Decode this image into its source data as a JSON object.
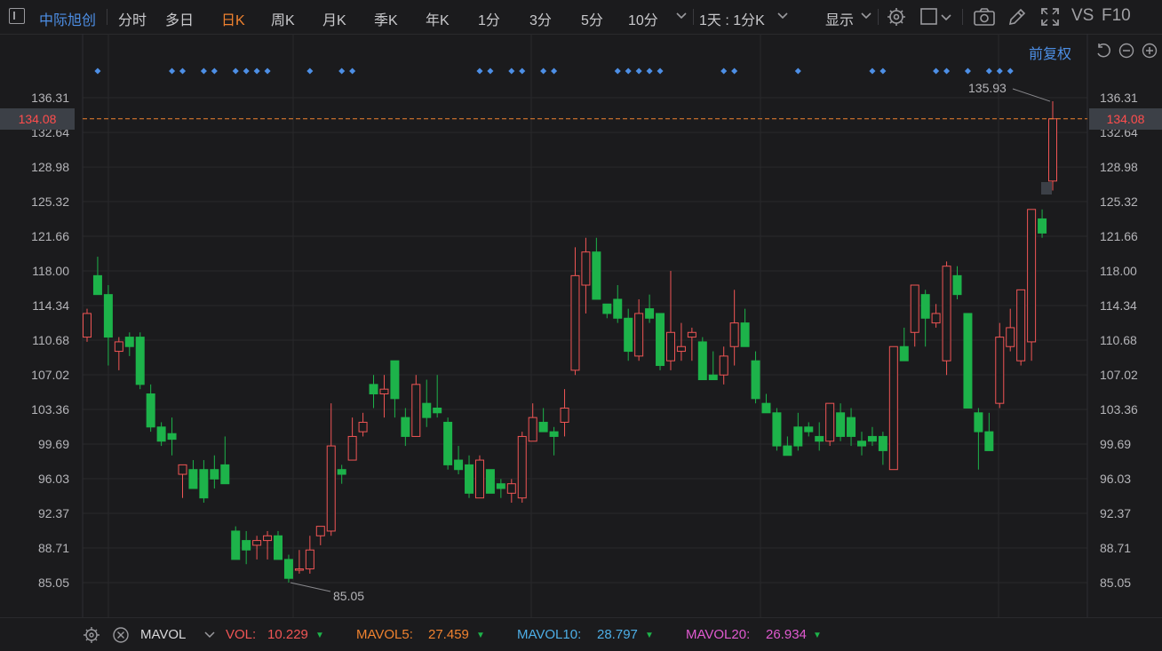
{
  "toolbar": {
    "stock_name": "中际旭创",
    "periods": [
      "分时",
      "多日",
      "日K",
      "周K",
      "月K",
      "季K",
      "年K",
      "1分",
      "3分",
      "5分",
      "10分"
    ],
    "active_period": "日K",
    "period_dropdown": "1天 : 1分K",
    "display_label": "显示",
    "vs_label": "VS",
    "f10_label": "F10"
  },
  "chart": {
    "adjust_label": "前复权",
    "current_price": "134.08",
    "high_label": "135.93",
    "low_label": "85.05",
    "y_ticks": [
      "136.31",
      "132.64",
      "128.98",
      "125.32",
      "121.66",
      "118.00",
      "114.34",
      "110.68",
      "107.02",
      "103.36",
      "99.69",
      "96.03",
      "92.37",
      "88.71",
      "85.05"
    ],
    "colors": {
      "up": "#f05555",
      "down": "#1db34a",
      "accent": "#f0822f",
      "blue": "#4d8fe6"
    }
  },
  "chart_data": {
    "type": "candlestick",
    "ylim": [
      83.0,
      139.0
    ],
    "ohlc": [
      [
        111.0,
        114.0,
        110.5,
        113.5
      ],
      [
        117.5,
        119.5,
        115.5,
        115.5
      ],
      [
        115.5,
        116.5,
        108.0,
        111.0
      ],
      [
        109.5,
        111.0,
        107.5,
        110.5
      ],
      [
        111.0,
        111.5,
        109.0,
        110.0
      ],
      [
        111.0,
        111.5,
        105.5,
        106.0
      ],
      [
        105.0,
        106.0,
        101.0,
        101.5
      ],
      [
        101.5,
        102.0,
        99.5,
        100.0
      ],
      [
        100.8,
        102.5,
        98.5,
        100.2
      ],
      [
        96.5,
        97.5,
        94.0,
        97.5
      ],
      [
        97.0,
        98.0,
        95.0,
        95.0
      ],
      [
        97.0,
        98.0,
        93.5,
        94.0
      ],
      [
        97.0,
        98.5,
        95.0,
        96.0
      ],
      [
        97.5,
        100.5,
        95.5,
        95.5
      ],
      [
        90.5,
        91.0,
        87.5,
        87.5
      ],
      [
        89.5,
        90.5,
        87.0,
        88.5
      ],
      [
        89.0,
        90.0,
        87.5,
        89.5
      ],
      [
        89.5,
        90.5,
        87.5,
        90.0
      ],
      [
        90.0,
        90.5,
        87.5,
        87.5
      ],
      [
        87.5,
        88.0,
        85.05,
        85.5
      ],
      [
        86.5,
        88.5,
        86.0,
        86.5
      ],
      [
        86.5,
        90.0,
        86.0,
        88.5
      ],
      [
        90.0,
        91.0,
        89.0,
        91.0
      ],
      [
        90.5,
        104.0,
        90.0,
        99.5
      ],
      [
        97.0,
        97.5,
        95.5,
        96.5
      ],
      [
        98.0,
        102.5,
        98.0,
        100.5
      ],
      [
        101.0,
        103.0,
        100.5,
        102.0
      ],
      [
        106.0,
        107.0,
        103.5,
        105.0
      ],
      [
        105.0,
        107.0,
        102.5,
        105.5
      ],
      [
        108.5,
        108.5,
        102.5,
        104.5
      ],
      [
        102.5,
        103.5,
        99.5,
        100.5
      ],
      [
        100.5,
        107.0,
        100.5,
        106.0
      ],
      [
        104.0,
        106.5,
        101.5,
        102.5
      ],
      [
        103.5,
        107.0,
        102.5,
        103.0
      ],
      [
        102.0,
        102.5,
        97.0,
        97.5
      ],
      [
        98.0,
        99.5,
        96.5,
        97.0
      ],
      [
        97.5,
        98.5,
        94.0,
        94.5
      ],
      [
        94.0,
        98.5,
        94.0,
        98.0
      ],
      [
        97.0,
        97.0,
        94.5,
        94.5
      ],
      [
        95.5,
        96.0,
        94.0,
        95.0
      ],
      [
        94.5,
        96.0,
        93.5,
        95.5
      ],
      [
        94.0,
        101.0,
        93.5,
        100.5
      ],
      [
        100.0,
        104.0,
        100.0,
        102.5
      ],
      [
        102.0,
        103.5,
        101.0,
        101.0
      ],
      [
        101.0,
        101.5,
        98.5,
        100.5
      ],
      [
        102.0,
        105.5,
        100.5,
        103.5
      ],
      [
        107.5,
        120.5,
        107.0,
        117.5
      ],
      [
        116.5,
        121.5,
        113.5,
        120.0
      ],
      [
        120.0,
        121.5,
        115.0,
        115.0
      ],
      [
        114.5,
        114.5,
        113.0,
        113.5
      ],
      [
        115.0,
        116.5,
        112.5,
        113.0
      ],
      [
        113.0,
        114.0,
        108.5,
        109.5
      ],
      [
        109.0,
        115.0,
        108.5,
        113.5
      ],
      [
        114.0,
        115.5,
        112.5,
        113.0
      ],
      [
        113.5,
        113.5,
        107.5,
        108.0
      ],
      [
        108.5,
        118.0,
        107.5,
        111.5
      ],
      [
        109.5,
        112.5,
        108.5,
        110.0
      ],
      [
        111.0,
        112.0,
        108.5,
        111.5
      ],
      [
        110.5,
        111.0,
        106.5,
        106.5
      ],
      [
        107.0,
        109.5,
        106.5,
        106.5
      ],
      [
        107.0,
        110.0,
        106.0,
        109.0
      ],
      [
        110.0,
        116.0,
        108.0,
        112.5
      ],
      [
        112.5,
        114.0,
        110.0,
        110.0
      ],
      [
        108.5,
        109.5,
        104.0,
        104.5
      ],
      [
        104.0,
        105.0,
        103.0,
        103.0
      ],
      [
        103.0,
        103.5,
        99.0,
        99.5
      ],
      [
        99.5,
        100.5,
        98.5,
        98.5
      ],
      [
        101.5,
        103.0,
        99.0,
        99.5
      ],
      [
        101.5,
        102.0,
        100.5,
        101.0
      ],
      [
        100.5,
        102.0,
        99.0,
        100.0
      ],
      [
        100.0,
        104.0,
        99.5,
        104.0
      ],
      [
        103.0,
        104.0,
        100.0,
        100.5
      ],
      [
        102.5,
        103.5,
        99.5,
        100.5
      ],
      [
        100.0,
        101.0,
        98.5,
        99.5
      ],
      [
        100.5,
        101.5,
        99.5,
        100.0
      ],
      [
        100.5,
        101.0,
        97.5,
        99.0
      ],
      [
        97.0,
        110.0,
        97.0,
        110.0
      ],
      [
        110.0,
        112.0,
        109.0,
        108.5
      ],
      [
        111.5,
        114.0,
        110.0,
        116.5
      ],
      [
        115.5,
        116.0,
        110.0,
        113.0
      ],
      [
        112.5,
        114.5,
        112.0,
        113.5
      ],
      [
        108.5,
        119.0,
        107.0,
        118.5
      ],
      [
        117.5,
        118.5,
        115.0,
        115.5
      ],
      [
        113.5,
        113.5,
        104.0,
        103.5
      ],
      [
        103.0,
        103.5,
        97.0,
        101.0
      ],
      [
        101.0,
        103.0,
        99.0,
        99.0
      ],
      [
        104.0,
        112.5,
        103.5,
        111.0
      ],
      [
        110.0,
        114.0,
        109.5,
        112.0
      ],
      [
        108.5,
        115.5,
        108.0,
        116.0
      ],
      [
        110.5,
        117.0,
        108.5,
        124.5
      ],
      [
        123.5,
        124.5,
        121.5,
        122.0
      ],
      [
        127.5,
        135.93,
        126.5,
        134.08
      ]
    ]
  },
  "volume": {
    "indicator": "MAVOL",
    "vol_label": "VOL:",
    "vol_value": "10.229",
    "mavol5_label": "MAVOL5:",
    "mavol5_value": "27.459",
    "mavol10_label": "MAVOL10:",
    "mavol10_value": "28.797",
    "mavol20_label": "MAVOL20:",
    "mavol20_value": "26.934",
    "colors": {
      "vol": "#f05555",
      "mavol5": "#f0822f",
      "mavol10": "#4daee6",
      "mavol20": "#e05ad0"
    }
  }
}
